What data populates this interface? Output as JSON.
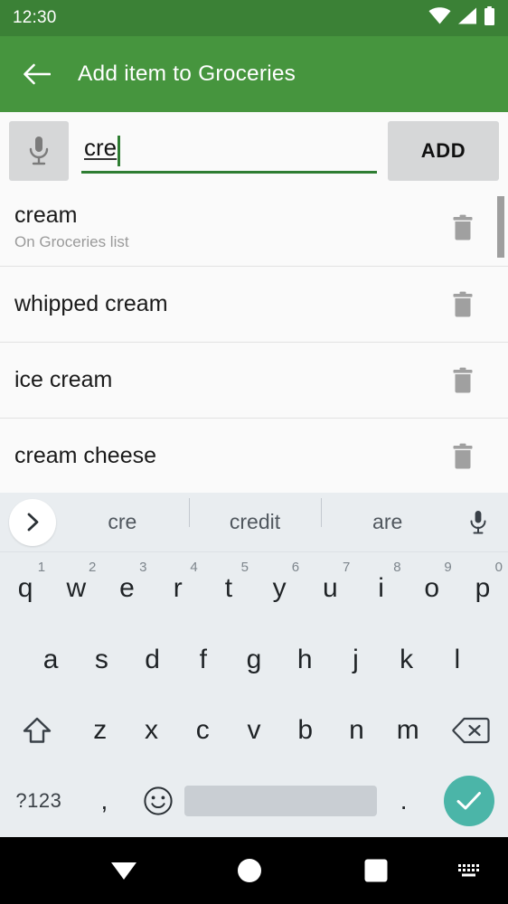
{
  "status_bar": {
    "time": "12:30",
    "icons": [
      "wifi-icon",
      "cellular-signal-icon",
      "battery-icon"
    ],
    "background": "#3b8136"
  },
  "app_bar": {
    "back_icon": "arrow-left-icon",
    "title": "Add item to Groceries",
    "background": "#46953e"
  },
  "input_row": {
    "mic_icon": "microphone-icon",
    "text_value": "cre",
    "placeholder": "",
    "add_label": "ADD",
    "accent": "#2e7d32"
  },
  "suggestions": [
    {
      "title": "cream",
      "subtitle": "On Groceries list",
      "delete_icon": "trash-icon"
    },
    {
      "title": "whipped cream",
      "subtitle": "",
      "delete_icon": "trash-icon"
    },
    {
      "title": "ice cream",
      "subtitle": "",
      "delete_icon": "trash-icon"
    },
    {
      "title": "cream cheese",
      "subtitle": "",
      "delete_icon": "trash-icon"
    }
  ],
  "keyboard": {
    "expand_icon": "chevron-right-icon",
    "suggestion_words": [
      "cre",
      "credit",
      "are"
    ],
    "voice_icon": "microphone-icon",
    "row1": [
      {
        "key": "q",
        "hint": "1"
      },
      {
        "key": "w",
        "hint": "2"
      },
      {
        "key": "e",
        "hint": "3"
      },
      {
        "key": "r",
        "hint": "4"
      },
      {
        "key": "t",
        "hint": "5"
      },
      {
        "key": "y",
        "hint": "6"
      },
      {
        "key": "u",
        "hint": "7"
      },
      {
        "key": "i",
        "hint": "8"
      },
      {
        "key": "o",
        "hint": "9"
      },
      {
        "key": "p",
        "hint": "0"
      }
    ],
    "row2": [
      "a",
      "s",
      "d",
      "f",
      "g",
      "h",
      "j",
      "k",
      "l"
    ],
    "row3": [
      "z",
      "x",
      "c",
      "v",
      "b",
      "n",
      "m"
    ],
    "shift_icon": "shift-up-arrow-icon",
    "backspace_icon": "backspace-delete-icon",
    "symbols_label": "?123",
    "comma_label": ",",
    "emoji_icon": "smiley-face-icon",
    "space_label": "",
    "period_label": ".",
    "enter_icon": "checkmark-icon",
    "enter_color": "#4bb5a8",
    "background": "#e9edf0"
  },
  "nav_bar": {
    "back_icon": "collapse-keyboard-down-triangle-icon",
    "home_icon": "home-circle-icon",
    "recents_icon": "recents-square-icon",
    "keyboard_switch_icon": "keyboard-switcher-icon",
    "background": "#000000"
  }
}
